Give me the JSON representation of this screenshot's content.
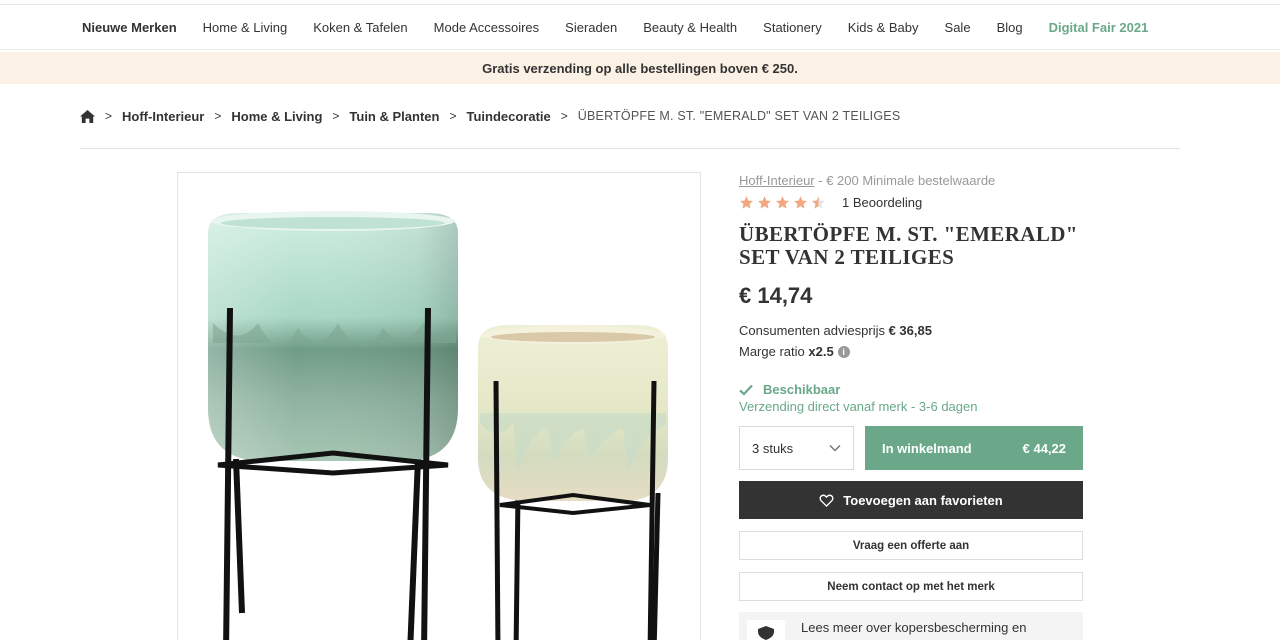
{
  "nav": {
    "items": [
      {
        "label": "Nieuwe Merken",
        "style": "bold"
      },
      {
        "label": "Home & Living",
        "style": "normal"
      },
      {
        "label": "Koken & Tafelen",
        "style": "normal"
      },
      {
        "label": "Mode Accessoires",
        "style": "normal"
      },
      {
        "label": "Sieraden",
        "style": "normal"
      },
      {
        "label": "Beauty & Health",
        "style": "normal"
      },
      {
        "label": "Stationery",
        "style": "normal"
      },
      {
        "label": "Kids & Baby",
        "style": "normal"
      },
      {
        "label": "Sale",
        "style": "normal"
      },
      {
        "label": "Blog",
        "style": "normal"
      },
      {
        "label": "Digital Fair 2021",
        "style": "accent"
      }
    ]
  },
  "promo": {
    "text": "Gratis verzending op alle bestellingen boven € 250."
  },
  "breadcrumb": {
    "crumbs": [
      "Hoff-Interieur",
      "Home & Living",
      "Tuin & Planten",
      "Tuindecoratie"
    ],
    "current": "ÜBERTÖPFE M. ST. \"EMERALD\" SET VAN 2 TEILIGES"
  },
  "product": {
    "brand": "Hoff-Interieur",
    "brand_suffix": " - € 200 Minimale bestelwaarde",
    "rating": 4.5,
    "reviews_label": "1 Beoordeling",
    "title": "ÜBERTÖPFE M. ST. \"EMERALD\" SET VAN 2 TEILIGES",
    "price": "€ 14,74",
    "rrp_label": "Consumenten adviesprijs",
    "rrp_value": "€ 36,85",
    "ratio_label": "Marge ratio",
    "ratio_value": "x2.5",
    "availability": "Beschikbaar",
    "shipping": "Verzending direct vanaf merk - 3-6 dagen",
    "quantity": "3 stuks",
    "add_to_cart_label": "In winkelmand",
    "cart_total": "€ 44,22",
    "favorite_label": "Toevoegen aan favorieten",
    "quote_label": "Vraag een offerte aan",
    "contact_label": "Neem contact op met het merk",
    "protection_text": "Lees meer over kopersbescherming en"
  },
  "colors": {
    "accent": "#6aa889",
    "star": "#f4a77f",
    "promo_bg": "#fbf1e4",
    "dark_button": "#333333"
  },
  "icons": [
    "home-icon",
    "chevron-right-icon",
    "star-icon",
    "info-icon",
    "check-icon",
    "chevron-down-icon",
    "heart-icon",
    "shield-icon"
  ]
}
